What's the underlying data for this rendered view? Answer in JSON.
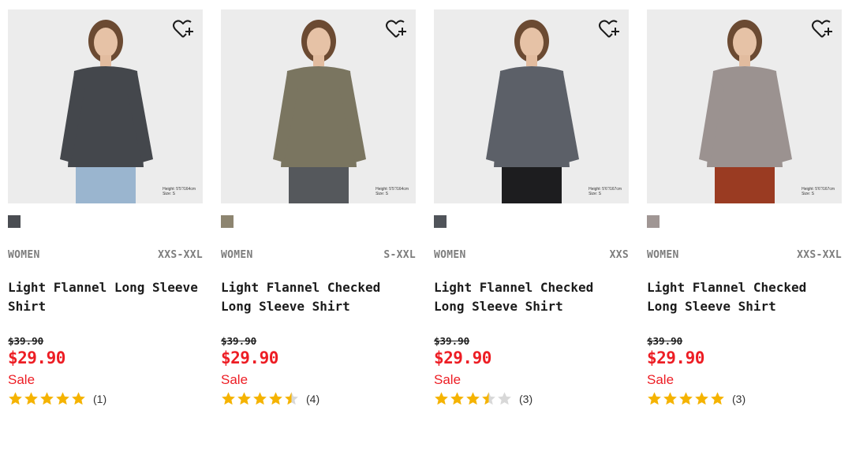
{
  "products": [
    {
      "category": "WOMEN",
      "sizes": "XXS-XXL",
      "name": "Light Flannel Long Sleeve Shirt",
      "original_price": "$39.90",
      "price": "$29.90",
      "sale_label": "Sale",
      "rating": 5,
      "review_count": "(1)",
      "swatch_color": "#4a4d52",
      "photo_caption": "Height: 5'5\"/164cm\nSize: S",
      "shirt_color": "#44474c",
      "pants_color": "#9ab5cf"
    },
    {
      "category": "WOMEN",
      "sizes": "S-XXL",
      "name": "Light Flannel Checked Long Sleeve Shirt",
      "original_price": "$39.90",
      "price": "$29.90",
      "sale_label": "Sale",
      "rating": 4.5,
      "review_count": "(4)",
      "swatch_color": "#8d8570",
      "photo_caption": "Height: 5'5\"/164cm\nSize: S",
      "shirt_color": "#7a7560",
      "pants_color": "#55585c"
    },
    {
      "category": "WOMEN",
      "sizes": "XXS",
      "name": "Light Flannel Checked Long Sleeve Shirt",
      "original_price": "$39.90",
      "price": "$29.90",
      "sale_label": "Sale",
      "rating": 3.5,
      "review_count": "(3)",
      "swatch_color": "#50545a",
      "photo_caption": "Height: 5'6\"/167cm\nSize: S",
      "shirt_color": "#5c6068",
      "pants_color": "#1d1d1f"
    },
    {
      "category": "WOMEN",
      "sizes": "XXS-XXL",
      "name": "Light Flannel Checked Long Sleeve Shirt",
      "original_price": "$39.90",
      "price": "$29.90",
      "sale_label": "Sale",
      "rating": 5,
      "review_count": "(3)",
      "swatch_color": "#a09694",
      "photo_caption": "Height: 5'6\"/167cm\nSize: S",
      "shirt_color": "#9b9290",
      "pants_color": "#9a3b22"
    }
  ],
  "colors": {
    "sale_red": "#ed1d24",
    "star_gold": "#f5b300",
    "star_empty": "#d8d8d8",
    "meta_gray": "#7d7d7d"
  },
  "icons": {
    "favorite": "heart-plus-icon",
    "star": "star-icon"
  }
}
